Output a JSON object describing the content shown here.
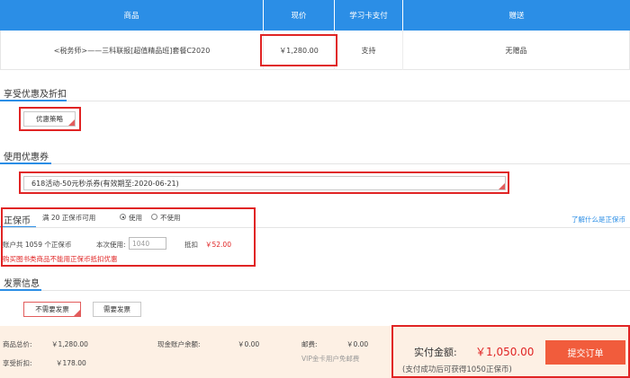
{
  "table": {
    "headers": [
      "商品",
      "现价",
      "学习卡支付",
      "赠送"
    ],
    "row": {
      "product": "<税务师>——三科联报[超值精品班]套餐C2020",
      "price": "￥1,280.00",
      "card_pay": "支持",
      "gift": "无赠品"
    }
  },
  "discount": {
    "title": "享受优惠及折扣",
    "option": "优惠策略"
  },
  "coupon": {
    "title": "使用优惠券",
    "selected": "618活动-50元秒杀券(有效期至:2020-06-21)"
  },
  "zhengbao": {
    "title": "正保币",
    "rule": "满 20 正保币可用",
    "use_label": "使用",
    "nouse_label": "不使用",
    "help_link": "了解什么是正保币",
    "balance_text": "账户共 1059 个正保币",
    "this_use_label": "本次使用:",
    "this_use_placeholder": "1040",
    "offset_label": "抵扣",
    "offset_value": "￥52.00",
    "warning": "购买图书类商品不能用正保币抵扣优惠"
  },
  "invoice": {
    "title": "发票信息",
    "no_invoice": "不需要发票",
    "need_invoice": "需要发票"
  },
  "summary": {
    "total_label": "商品总价:",
    "total_value": "￥1,280.00",
    "discount_label": "享受折扣:",
    "discount_value": "￥178.00",
    "cash_label": "现金账户余额:",
    "cash_value": "￥0.00",
    "postage_label": "邮费:",
    "postage_value": "￥0.00",
    "postage_note": "VIP金卡用户免邮费",
    "pay_label": "实付金额:",
    "pay_value": "￥1,050.00",
    "earn_note": "(支付成功后可获得1050正保币)",
    "submit_label": "提交订单"
  },
  "colors": {
    "header_blue": "#2b8ee6",
    "highlight_red": "#e02424",
    "price_red": "#e02424",
    "submit_orange": "#f15c3c",
    "footer_bg": "#fdf0e4"
  }
}
